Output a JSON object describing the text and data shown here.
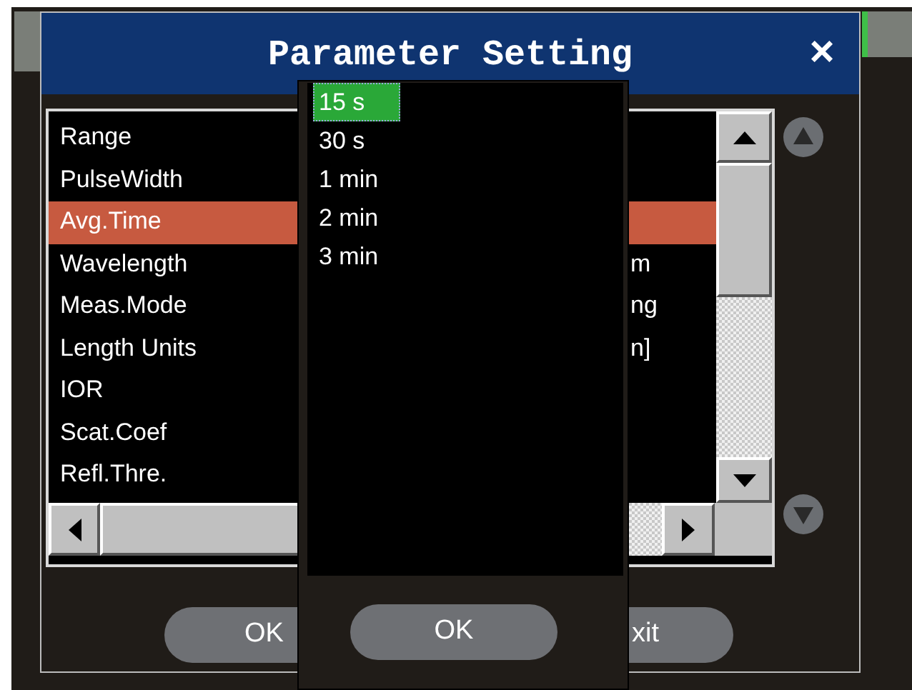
{
  "dialog": {
    "title": "Parameter Setting",
    "close": "×"
  },
  "parameters": [
    {
      "label": "Range",
      "selected": false
    },
    {
      "label": "PulseWidth",
      "selected": false
    },
    {
      "label": "Avg.Time",
      "selected": true
    },
    {
      "label": "Wavelength",
      "value": "m",
      "selected": false
    },
    {
      "label": "Meas.Mode",
      "value": "ng",
      "selected": false
    },
    {
      "label": "Length Units",
      "value": "n]",
      "selected": false
    },
    {
      "label": "IOR",
      "selected": false
    },
    {
      "label": "Scat.Coef",
      "selected": false
    },
    {
      "label": "Refl.Thre.",
      "selected": false
    }
  ],
  "buttons": [
    {
      "label": "OK"
    },
    {
      "label": "xit"
    }
  ],
  "popup": {
    "options": [
      {
        "label": "15 s",
        "selected": true
      },
      {
        "label": "30 s",
        "selected": false
      },
      {
        "label": "1 min",
        "selected": false
      },
      {
        "label": "2 min",
        "selected": false
      },
      {
        "label": "3 min",
        "selected": false
      }
    ],
    "ok_button": "OK"
  }
}
